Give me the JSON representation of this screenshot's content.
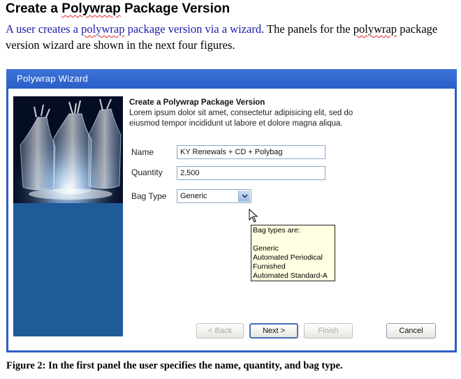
{
  "document": {
    "heading_prefix": "Create a ",
    "heading_underlined": "Polywrap",
    "heading_suffix": " Package Version",
    "intro_blue_1": "A user creates a ",
    "intro_blue_underlined": "polywrap",
    "intro_blue_2": " package version via a wizard.",
    "intro_black_1": " The panels for the ",
    "intro_black_underlined": "polywrap",
    "intro_black_2": " package version wizard are shown in the next four figures.",
    "caption": "Figure 2: In the first panel the user specifies the name, quantity, and bag type."
  },
  "wizard": {
    "title": "Polywrap Wizard",
    "panel_title": "Create a Polywrap Package Version",
    "panel_description": "Lorem ipsum dolor sit amet, consectetur adipisicing elit, sed do eiusmod tempor incididunt ut labore et dolore magna aliqua.",
    "fields": {
      "name_label": "Name",
      "name_value": "KY Renewals + CD + Polybag",
      "quantity_label": "Quantity",
      "quantity_value": "2,500",
      "bag_type_label": "Bag Type",
      "bag_type_value": "Generic"
    },
    "tooltip": {
      "heading": "Bag types are:",
      "items": [
        "Generic",
        "Automated Periodical",
        "Furnished",
        "Automated Standard-A"
      ]
    },
    "buttons": {
      "back": "< Back",
      "next": "Next >",
      "finish": "Finish",
      "cancel": "Cancel"
    }
  },
  "colors": {
    "window_frame": "#2b5fc4",
    "side_panel": "#1f5a99",
    "tooltip_bg": "#ffffe1",
    "intro_link": "#1a1aa8"
  }
}
